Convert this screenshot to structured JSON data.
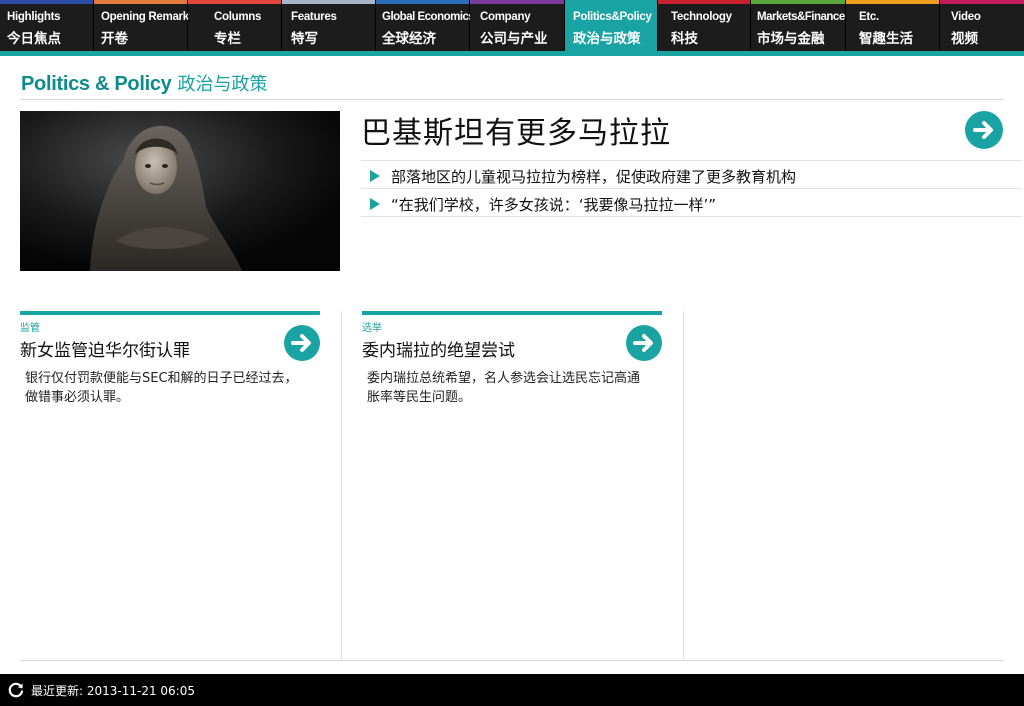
{
  "nav": {
    "tabs": [
      {
        "en": "Highlights",
        "zh": "今日焦点",
        "color": "#2b4fa8"
      },
      {
        "en": "Opening Remarks",
        "zh": "开卷",
        "color": "#e07a3c"
      },
      {
        "en": "Columns",
        "zh": "专栏",
        "color": "#e0483c"
      },
      {
        "en": "Features",
        "zh": "特写",
        "color": "#a8b4c8"
      },
      {
        "en": "Global Economics",
        "zh": "全球经济",
        "color": "#2b6fb8"
      },
      {
        "en": "Company",
        "zh": "公司与产业",
        "color": "#7b3c9c"
      },
      {
        "en": "Politics&Policy",
        "zh": "政治与政策",
        "color": "#1aa3a3"
      },
      {
        "en": "Technology",
        "zh": "科技",
        "color": "#c8202c"
      },
      {
        "en": "Markets&Finance",
        "zh": "市场与金融",
        "color": "#5aa83c"
      },
      {
        "en": "Etc.",
        "zh": "智趣生活",
        "color": "#f0a020"
      },
      {
        "en": "Video",
        "zh": "视频",
        "color": "#c01c5c"
      }
    ],
    "active_index": 6,
    "accent": "#1aa3a3"
  },
  "section": {
    "title_en": "Politics & Policy",
    "title_zh": "政治与政策"
  },
  "feature": {
    "headline": "巴基斯坦有更多马拉拉",
    "bullets": [
      "部落地区的儿童视马拉拉为榜样，促使政府建了更多教育机构",
      "“在我们学校，许多女孩说：‘我要像马拉拉一样’”"
    ],
    "arrow_icon": "arrow-right-icon"
  },
  "stories": [
    {
      "category": "监管",
      "title": "新女监管迫华尔街认罪",
      "description": "银行仅付罚款便能与SEC和解的日子已经过去，做错事必须认罪。"
    },
    {
      "category": "选举",
      "title": "委内瑞拉的绝望尝试",
      "description": "委内瑞拉总统希望，名人参选会让选民忘记高通胀率等民生问题。"
    }
  ],
  "footer": {
    "last_updated_label": "最近更新: 2013-11-21 06:05",
    "refresh_icon": "refresh-icon"
  }
}
